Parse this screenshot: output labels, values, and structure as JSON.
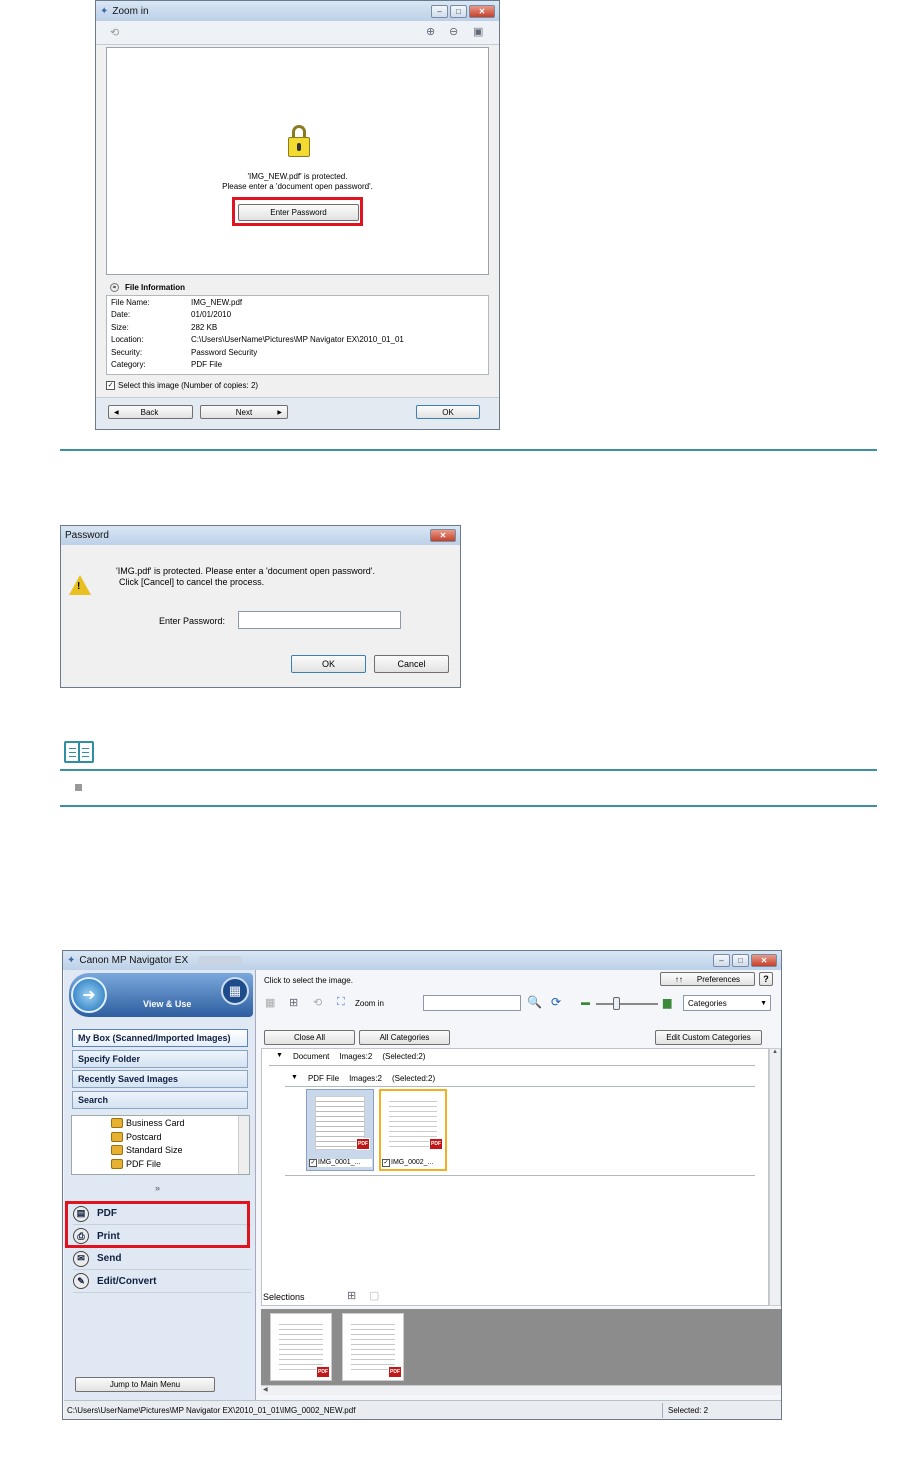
{
  "zoom": {
    "title": "Zoom in",
    "message_line1": "'IMG_NEW.pdf' is protected.",
    "message_line2": "Please enter a 'document open password'.",
    "enter_password": "Enter Password",
    "file_info_title": "File Information",
    "rows": [
      {
        "label": "File Name:",
        "value": "IMG_NEW.pdf"
      },
      {
        "label": "Date:",
        "value": "01/01/2010"
      },
      {
        "label": "Size:",
        "value": "282 KB"
      },
      {
        "label": "Location:",
        "value": "C:\\Users\\UserName\\Pictures\\MP Navigator EX\\2010_01_01"
      },
      {
        "label": "Security:",
        "value": "Password Security"
      },
      {
        "label": "Category:",
        "value": "PDF File"
      }
    ],
    "select_check": "Select this image (Number of copies: 2)",
    "back": "Back",
    "next": "Next",
    "ok": "OK"
  },
  "password": {
    "title": "Password",
    "msg1": "'IMG.pdf' is protected. Please enter a 'document open password'.",
    "msg2": "Click [Cancel] to cancel the process.",
    "field_label": "Enter Password:",
    "field_value": "",
    "ok": "OK",
    "cancel": "Cancel"
  },
  "navigator": {
    "title": "Canon MP Navigator EX",
    "view_use": "View & Use",
    "nav": [
      "My Box (Scanned/Imported Images)",
      "Specify Folder",
      "Recently Saved Images",
      "Search"
    ],
    "tree": [
      "Business Card",
      "Postcard",
      "Standard Size",
      "PDF File"
    ],
    "tasks": [
      "PDF",
      "Print",
      "Send",
      "Edit/Convert"
    ],
    "jump": "Jump to Main Menu",
    "hint": "Click to select the image.",
    "preferences": "Preferences",
    "help": "?",
    "zoom_in": "Zoom in",
    "categories": "Categories",
    "close_all": "Close All",
    "all_categories": "All Categories",
    "edit_custom": "Edit Custom Categories",
    "group1": {
      "name": "Document",
      "images": "Images:2",
      "selected": "(Selected:2)"
    },
    "group2": {
      "name": "PDF File",
      "images": "Images:2",
      "selected": "(Selected:2)"
    },
    "thumbs": [
      "IMG_0001_...",
      "IMG_0002_..."
    ],
    "selections": "Selections",
    "path": "C:\\Users\\UserName\\Pictures\\MP Navigator EX\\2010_01_01\\IMG_0002_NEW.pdf",
    "selected_count": "Selected: 2"
  },
  "colors": {
    "accent_line": "#3f8fa2",
    "highlight": "#e0141e"
  }
}
